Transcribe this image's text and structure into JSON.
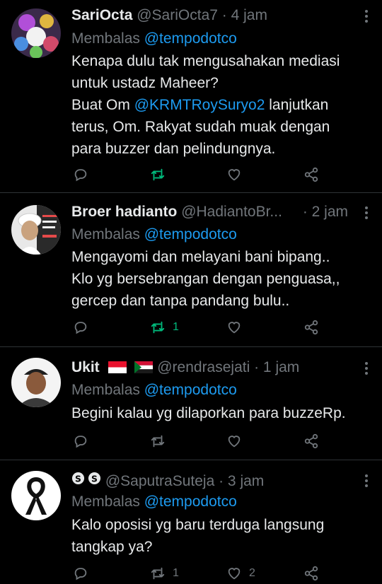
{
  "tweets": [
    {
      "name": "SariOcta",
      "handle": "@SariOcta7",
      "time": "· 4 jam",
      "reply_prefix": "Membalas",
      "reply_to": "@tempodotco",
      "body_line1": "Kenapa dulu tak mengusahakan mediasi",
      "body_line2": "untuk ustadz Maheer?",
      "body_line3a": "Buat Om ",
      "body_line3_mention": "@KRMTRoySuryo2",
      "body_line3b": " lanjutkan",
      "body_line4": "terus, Om. Rakyat sudah muak dengan",
      "body_line5": "para buzzer dan pelindungnya.",
      "retweet_count": "",
      "like_count": ""
    },
    {
      "name": "Broer hadianto",
      "handle": "@HadiantoBr...",
      "time": "· 2 jam",
      "reply_prefix": "Membalas",
      "reply_to": "@tempodotco",
      "body_line1": "Mengayomi dan melayani bani bipang..",
      "body_line2": "Klo yg bersebrangan dengan penguasa,,",
      "body_line3": "gercep dan tanpa pandang bulu..",
      "retweet_count": "1",
      "like_count": ""
    },
    {
      "name": "Ukit",
      "handle": "@rendrasejati",
      "time": "· 1 jam",
      "reply_prefix": "Membalas",
      "reply_to": "@tempodotco",
      "body_line1": "Begini kalau yg dilaporkan para buzzeRp.",
      "retweet_count": "",
      "like_count": ""
    },
    {
      "name": "SS",
      "handle": "@SaputraSuteja",
      "time": "· 3 jam",
      "reply_prefix": "Membalas",
      "reply_to": "@tempodotco",
      "body_line1": "Kalo oposisi yg baru terduga langsung",
      "body_line2": "tangkap ya?",
      "retweet_count": "1",
      "like_count": "2"
    }
  ],
  "icons": {
    "reply": "reply-icon",
    "retweet": "retweet-icon",
    "like": "heart-icon",
    "share": "share-icon",
    "more": "more-icon"
  },
  "colors": {
    "background": "#000000",
    "link": "#1d9bf0",
    "muted": "#71767b",
    "retweet_green": "#00ba7c"
  }
}
